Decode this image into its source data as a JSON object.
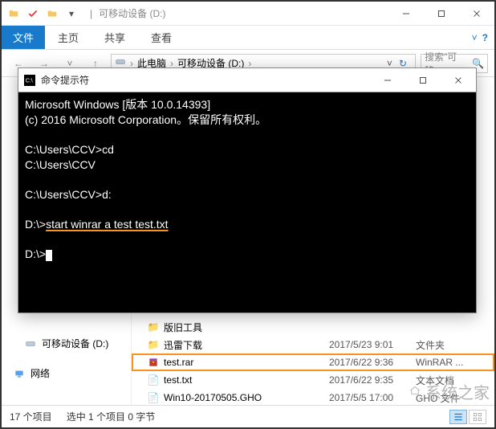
{
  "titlebar": {
    "title": "可移动设备 (D:)"
  },
  "ribbon": {
    "file": "文件",
    "tabs": [
      "主页",
      "共享",
      "查看"
    ]
  },
  "breadcrumb": {
    "items": [
      "此电脑",
      "可移动设备 (D:)"
    ]
  },
  "search": {
    "placeholder": "搜索\"可移..."
  },
  "sidebar": {
    "items": [
      {
        "label": "可移动设备 (D:)"
      },
      {
        "label": "网络"
      }
    ]
  },
  "files": [
    {
      "name": "版旧工具",
      "date": "",
      "type": ""
    },
    {
      "name": "迅雷下载",
      "date": "2017/5/23 9:01",
      "type": "文件夹"
    },
    {
      "name": "test.rar",
      "date": "2017/6/22 9:36",
      "type": "WinRAR ...",
      "highlight": true
    },
    {
      "name": "test.txt",
      "date": "2017/6/22 9:35",
      "type": "文本文档"
    },
    {
      "name": "Win10-20170505.GHO",
      "date": "2017/5/5 17:00",
      "type": "GHO 文件"
    }
  ],
  "statusbar": {
    "count": "17 个项目",
    "selection": "选中 1 个项目  0 字节"
  },
  "cmd": {
    "title": "命令提示符",
    "lines": {
      "l1": "Microsoft Windows [版本 10.0.14393]",
      "l2": "(c) 2016 Microsoft Corporation。保留所有权利。",
      "l3": "C:\\Users\\CCV>cd",
      "l4": "C:\\Users\\CCV",
      "l5": "C:\\Users\\CCV>d:",
      "l6p": "D:\\>",
      "l6c": "start winrar a test test.txt",
      "l7": "D:\\>"
    }
  },
  "watermark": "系统之家"
}
